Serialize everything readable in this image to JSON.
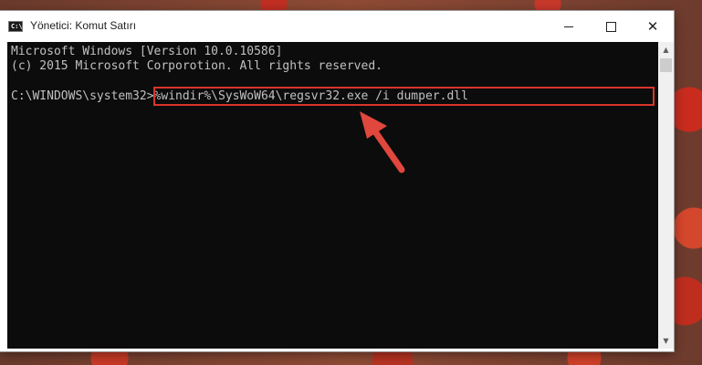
{
  "window": {
    "title": "Yönetici: Komut Satırı",
    "icon_label": "C:\\",
    "minimize_icon": "minimize-icon",
    "maximize_icon": "maximize-icon",
    "close_symbol": "✕"
  },
  "console": {
    "line1": "Microsoft Windows [Version 10.0.10586]",
    "line2": "(c) 2015 Microsoft Corporotion. All rights reserved.",
    "prompt": "C:\\WINDOWS\\system32>",
    "command": "%windir%\\SysWoW64\\regsvr32.exe /i dumper.dll"
  },
  "scrollbar": {
    "up_symbol": "▲",
    "down_symbol": "▼"
  },
  "colors": {
    "highlight": "#d9352a",
    "arrow": "#e0473d",
    "console_bg": "#0c0c0c",
    "console_text": "#c0c0c0"
  }
}
